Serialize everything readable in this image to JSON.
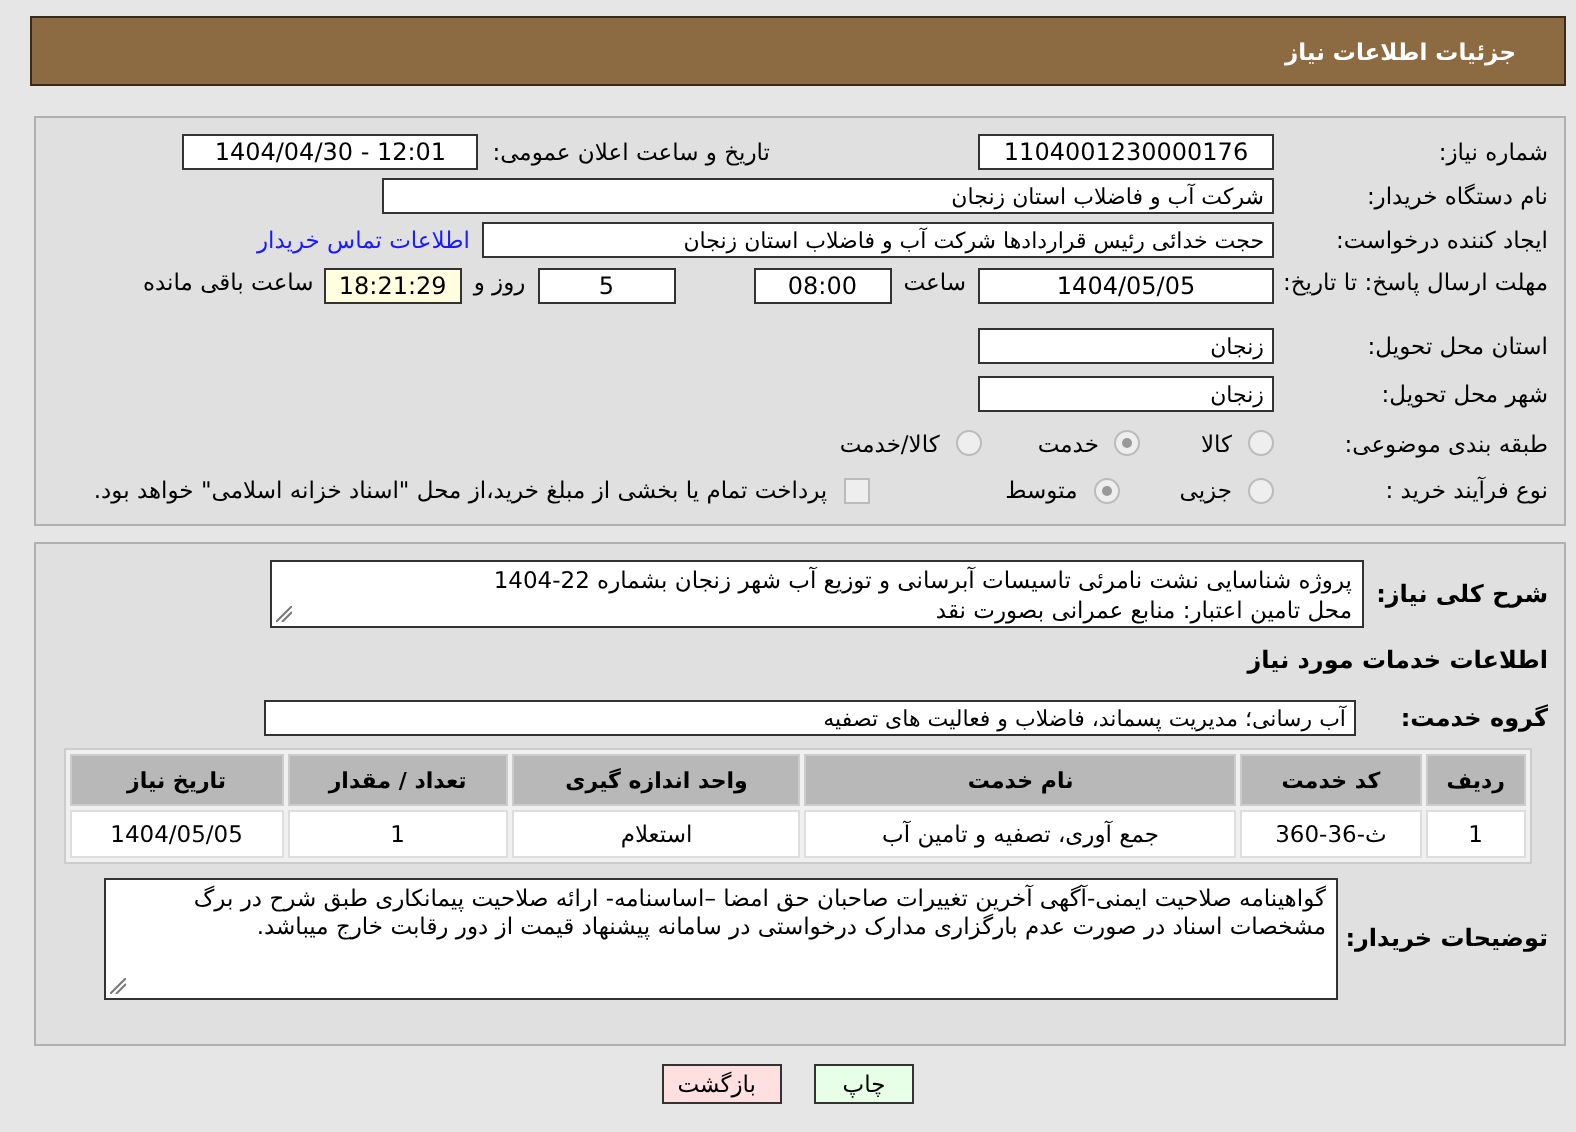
{
  "header": {
    "title": "جزئیات اطلاعات نیاز"
  },
  "need_number": {
    "label": "شماره نیاز:",
    "value": "1104001230000176"
  },
  "announce": {
    "label": "تاریخ و ساعت اعلان عمومی:",
    "value": "1404/04/30 - 12:01"
  },
  "buyer": {
    "label": "نام دستگاه خریدار:",
    "value": "شرکت آب و فاضلاب استان زنجان"
  },
  "creator": {
    "label": "ایجاد کننده درخواست:",
    "value": "حجت  خدائی رئیس قراردادها شرکت آب و فاضلاب استان زنجان",
    "link": "اطلاعات تماس خریدار"
  },
  "deadline": {
    "label": "مهلت ارسال پاسخ: تا تاریخ:",
    "date": "1404/05/05",
    "time_label": "ساعت",
    "time": "08:00",
    "days": "5",
    "days_label": "روز و",
    "remaining": "18:21:29",
    "remaining_label": "ساعت باقی مانده"
  },
  "province": {
    "label": "استان محل تحویل:",
    "value": "زنجان"
  },
  "city": {
    "label": "شهر محل تحویل:",
    "value": "زنجان"
  },
  "category": {
    "label": "طبقه بندی موضوعی:",
    "options": [
      {
        "label": "کالا",
        "selected": false
      },
      {
        "label": "خدمت",
        "selected": true
      },
      {
        "label": "کالا/خدمت",
        "selected": false
      }
    ]
  },
  "process": {
    "label": "نوع فرآیند خرید :",
    "options": [
      {
        "label": "جزیی",
        "selected": false
      },
      {
        "label": "متوسط",
        "selected": true
      }
    ],
    "payment": {
      "label": "پرداخت تمام یا بخشی از مبلغ خرید،از محل \"اسناد خزانه اسلامی\" خواهد بود.",
      "checked": false
    }
  },
  "summary": {
    "label": "شرح کلی نیاز:",
    "lines": [
      "پروژه شناسایی نشت نامرئی تاسیسات آبرسانی و توزیع آب شهر زنجان بشماره 22-1404",
      "محل تامین اعتبار: منابع عمرانی بصورت نقد"
    ]
  },
  "services_heading": "اطلاعات خدمات مورد نیاز",
  "service_group": {
    "label": "گروه خدمت:",
    "value": "آب رسانی؛ مدیریت پسماند، فاضلاب و فعالیت های تصفیه"
  },
  "table": {
    "columns": [
      "ردیف",
      "کد خدمت",
      "نام خدمت",
      "واحد اندازه گیری",
      "تعداد / مقدار",
      "تاریخ نیاز"
    ],
    "rows": [
      [
        "1",
        "ث-36-360",
        "جمع آوری، تصفیه و تامین آب",
        "استعلام",
        "1",
        "1404/05/05"
      ]
    ]
  },
  "notes": {
    "label": "توضیحات خریدار:",
    "value": "گواهینامه صلاحیت ایمنی-آگهی آخرین تغییرات صاحبان حق امضا –اساسنامه- ارائه صلاحیت پیمانکاری طبق شرح در برگ مشخصات اسناد در صورت عدم بارگزاری مدارک درخواستی در سامانه پیشنهاد قیمت از دور رقابت خارج میباشد."
  },
  "buttons": [
    {
      "label": "چاپ",
      "kind": "print"
    },
    {
      "label": "بازگشت",
      "kind": "back"
    }
  ]
}
